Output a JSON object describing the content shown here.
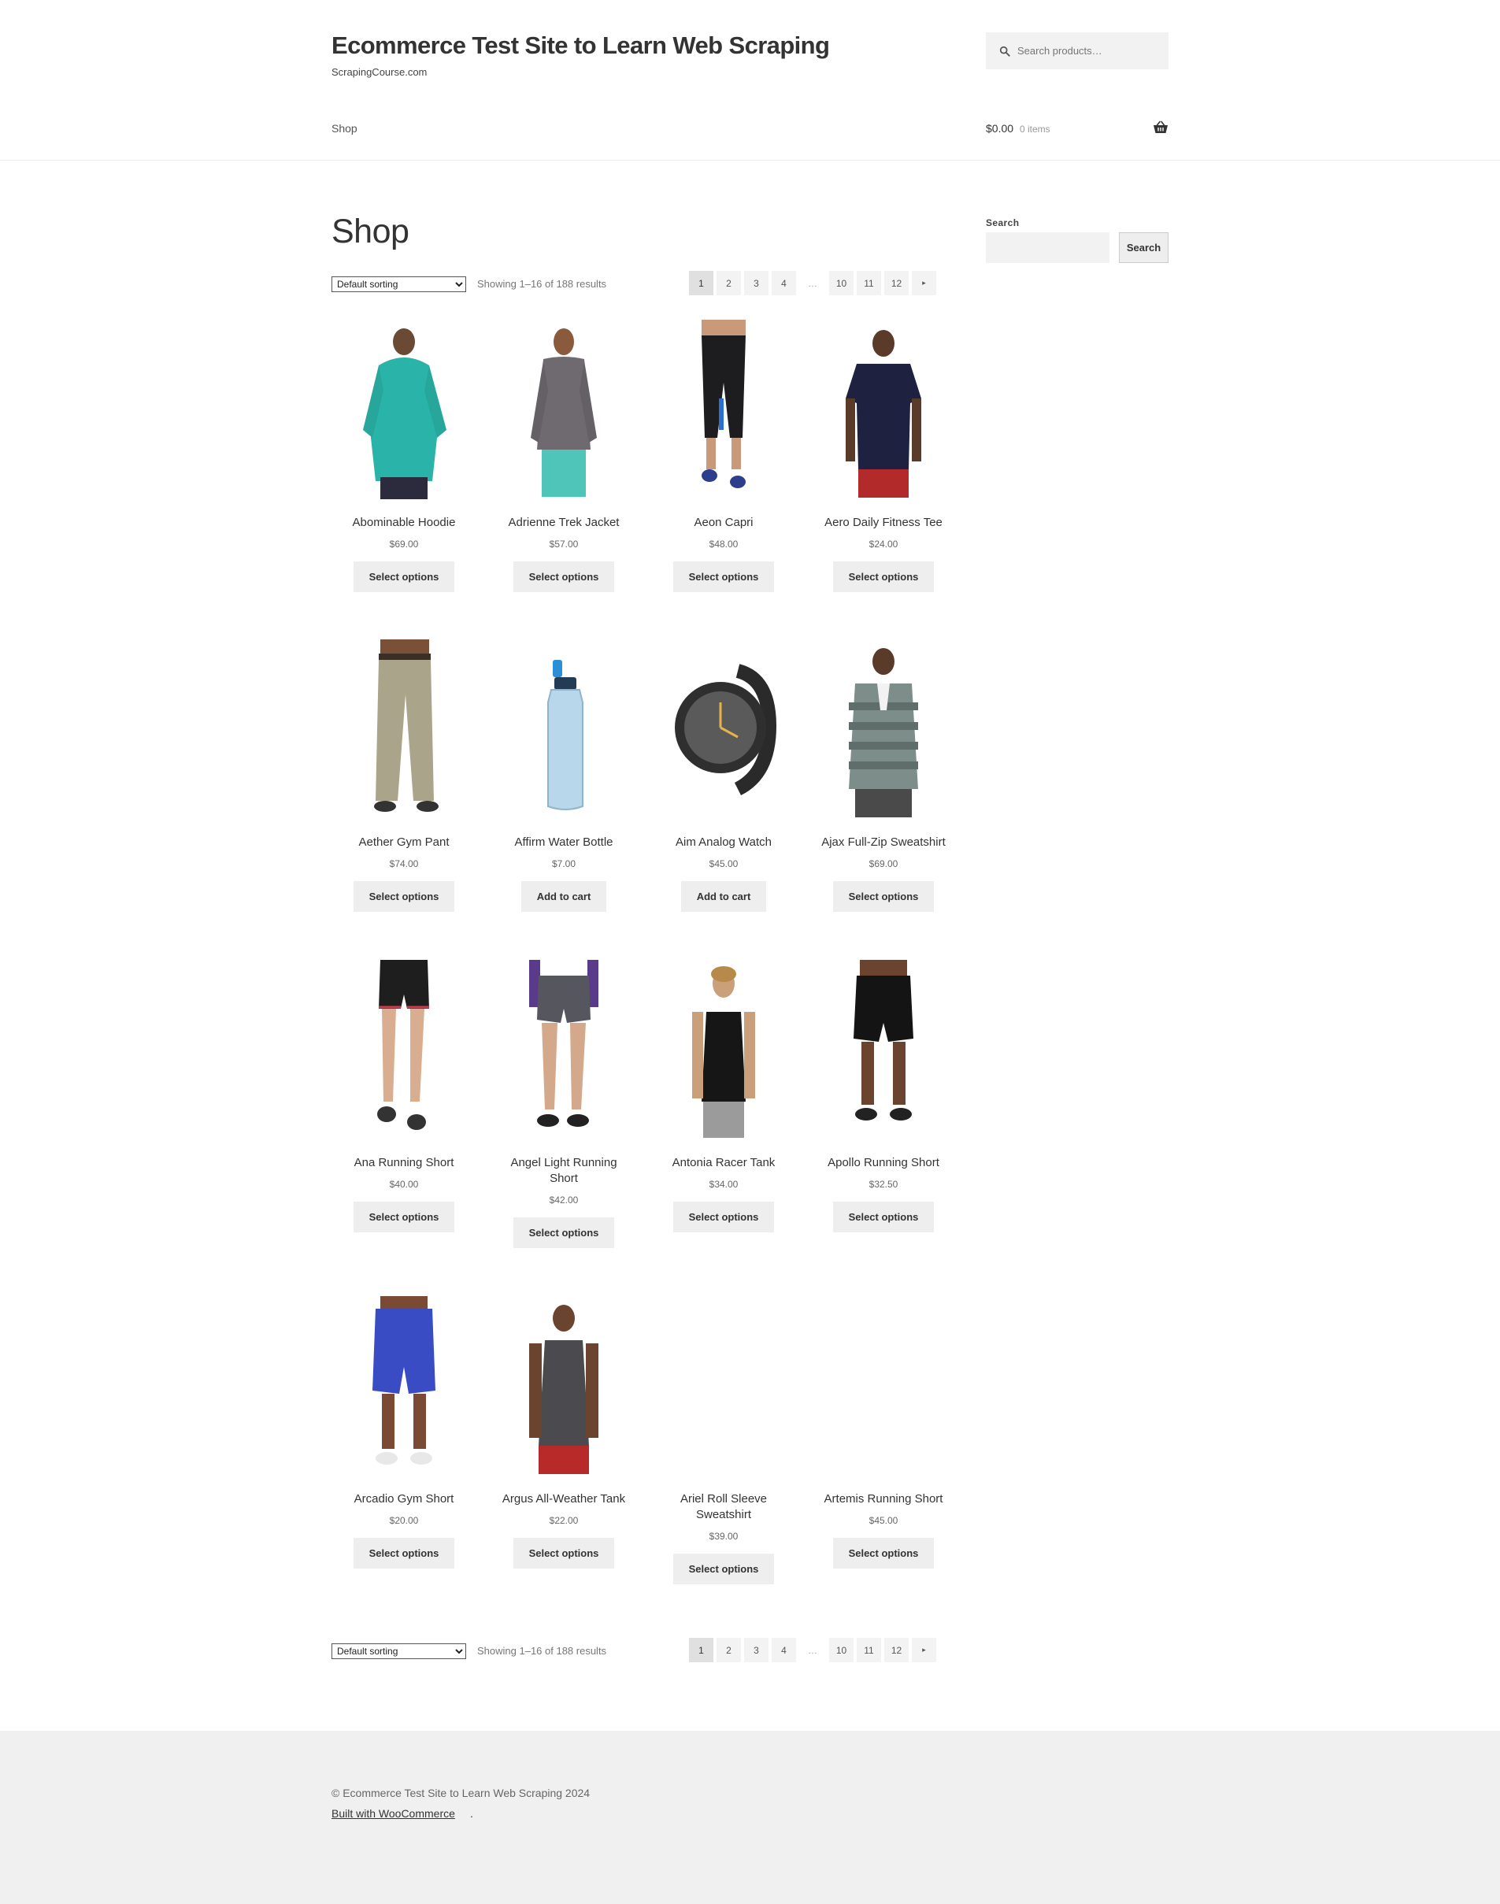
{
  "header": {
    "site_title": "Ecommerce Test Site to Learn Web Scraping",
    "tagline": "ScrapingCourse.com",
    "search_placeholder": "Search products…",
    "nav_shop": "Shop",
    "cart_amount": "$0.00",
    "cart_items": "0 items",
    "cart_icon": "basket-icon",
    "search_icon": "magnifier-icon"
  },
  "main": {
    "title": "Shop",
    "sorting": "Default sorting",
    "result_count": "Showing 1–16 of 188 results",
    "pagination": [
      "1",
      "2",
      "3",
      "4",
      "…",
      "10",
      "11",
      "12",
      "▸"
    ],
    "current_page": "1"
  },
  "products": [
    {
      "name": "Abominable Hoodie",
      "price": "$69.00",
      "button": "Select options",
      "image": "teal-hoodie"
    },
    {
      "name": "Adrienne Trek Jacket",
      "price": "$57.00",
      "button": "Select options",
      "image": "gray-jacket"
    },
    {
      "name": "Aeon Capri",
      "price": "$48.00",
      "button": "Select options",
      "image": "black-capri"
    },
    {
      "name": "Aero Daily Fitness Tee",
      "price": "$24.00",
      "button": "Select options",
      "image": "navy-tee"
    },
    {
      "name": "Aether Gym Pant",
      "price": "$74.00",
      "button": "Select options",
      "image": "khaki-pant"
    },
    {
      "name": "Affirm Water Bottle",
      "price": "$7.00",
      "button": "Add to cart",
      "image": "water-bottle"
    },
    {
      "name": "Aim Analog Watch",
      "price": "$45.00",
      "button": "Add to cart",
      "image": "analog-watch"
    },
    {
      "name": "Ajax Full-Zip Sweatshirt",
      "price": "$69.00",
      "button": "Select options",
      "image": "striped-sweatshirt"
    },
    {
      "name": "Ana Running Short",
      "price": "$40.00",
      "button": "Select options",
      "image": "running-short"
    },
    {
      "name": "Angel Light Running Short",
      "price": "$42.00",
      "button": "Select options",
      "image": "light-running-short"
    },
    {
      "name": "Antonia Racer Tank",
      "price": "$34.00",
      "button": "Select options",
      "image": "racer-tank"
    },
    {
      "name": "Apollo Running Short",
      "price": "$32.50",
      "button": "Select options",
      "image": "black-short"
    },
    {
      "name": "Arcadio Gym Short",
      "price": "$20.00",
      "button": "Select options",
      "image": "blue-gym-short"
    },
    {
      "name": "Argus All-Weather Tank",
      "price": "$22.00",
      "button": "Select options",
      "image": "gray-tank"
    },
    {
      "name": "Ariel Roll Sleeve Sweatshirt",
      "price": "$39.00",
      "button": "Select options",
      "image": ""
    },
    {
      "name": "Artemis Running Short",
      "price": "$45.00",
      "button": "Select options",
      "image": ""
    }
  ],
  "sidebar": {
    "search_label": "Search",
    "search_button": "Search"
  },
  "footer": {
    "copyright": "© Ecommerce Test Site to Learn Web Scraping 2024",
    "built_with": "Built with WooCommerce",
    "built_suffix": "."
  }
}
